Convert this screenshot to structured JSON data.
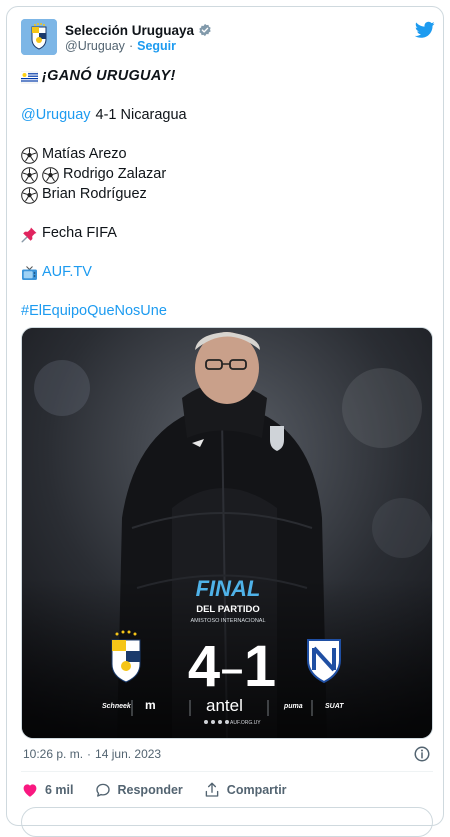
{
  "account": {
    "display_name": "Selección Uruguaya",
    "handle": "@Uruguay",
    "follow_label": "Seguir"
  },
  "tweet": {
    "headline": "¡GANÓ URUGUAY!",
    "mention": "@Uruguay",
    "score_line": "4-1 Nicaragua",
    "scorers": [
      "Matías Arezo",
      "Rodrigo Zalazar",
      "Brian Rodríguez"
    ],
    "fecha": "Fecha FIFA",
    "tv_link": "AUF.TV",
    "hashtag": "#ElEquipoQueNosUne"
  },
  "media": {
    "final_label": "FINAL",
    "subtitle": "DEL PARTIDO",
    "subsubtitle": "AMISTOSO INTERNACIONAL",
    "home_score": "4",
    "score_dash": "–",
    "away_score": "1",
    "sponsors": [
      "Schneek",
      "m",
      "antel",
      "puma",
      "SUAT"
    ],
    "web": "AUF.ORG.UY"
  },
  "footer": {
    "time": "10:26 p. m.",
    "date": "14 jun. 2023",
    "likes": "6 mil",
    "reply_label": "Responder",
    "share_label": "Compartir"
  },
  "colors": {
    "accent": "#1d9bf0",
    "like": "#f91880",
    "text_secondary": "#536471"
  },
  "icons": [
    "uruguay-flag-icon",
    "soccer-ball-icon",
    "pushpin-icon",
    "television-icon",
    "twitter-bird-icon",
    "verified-badge-icon",
    "info-icon",
    "heart-icon",
    "reply-icon",
    "share-icon"
  ]
}
